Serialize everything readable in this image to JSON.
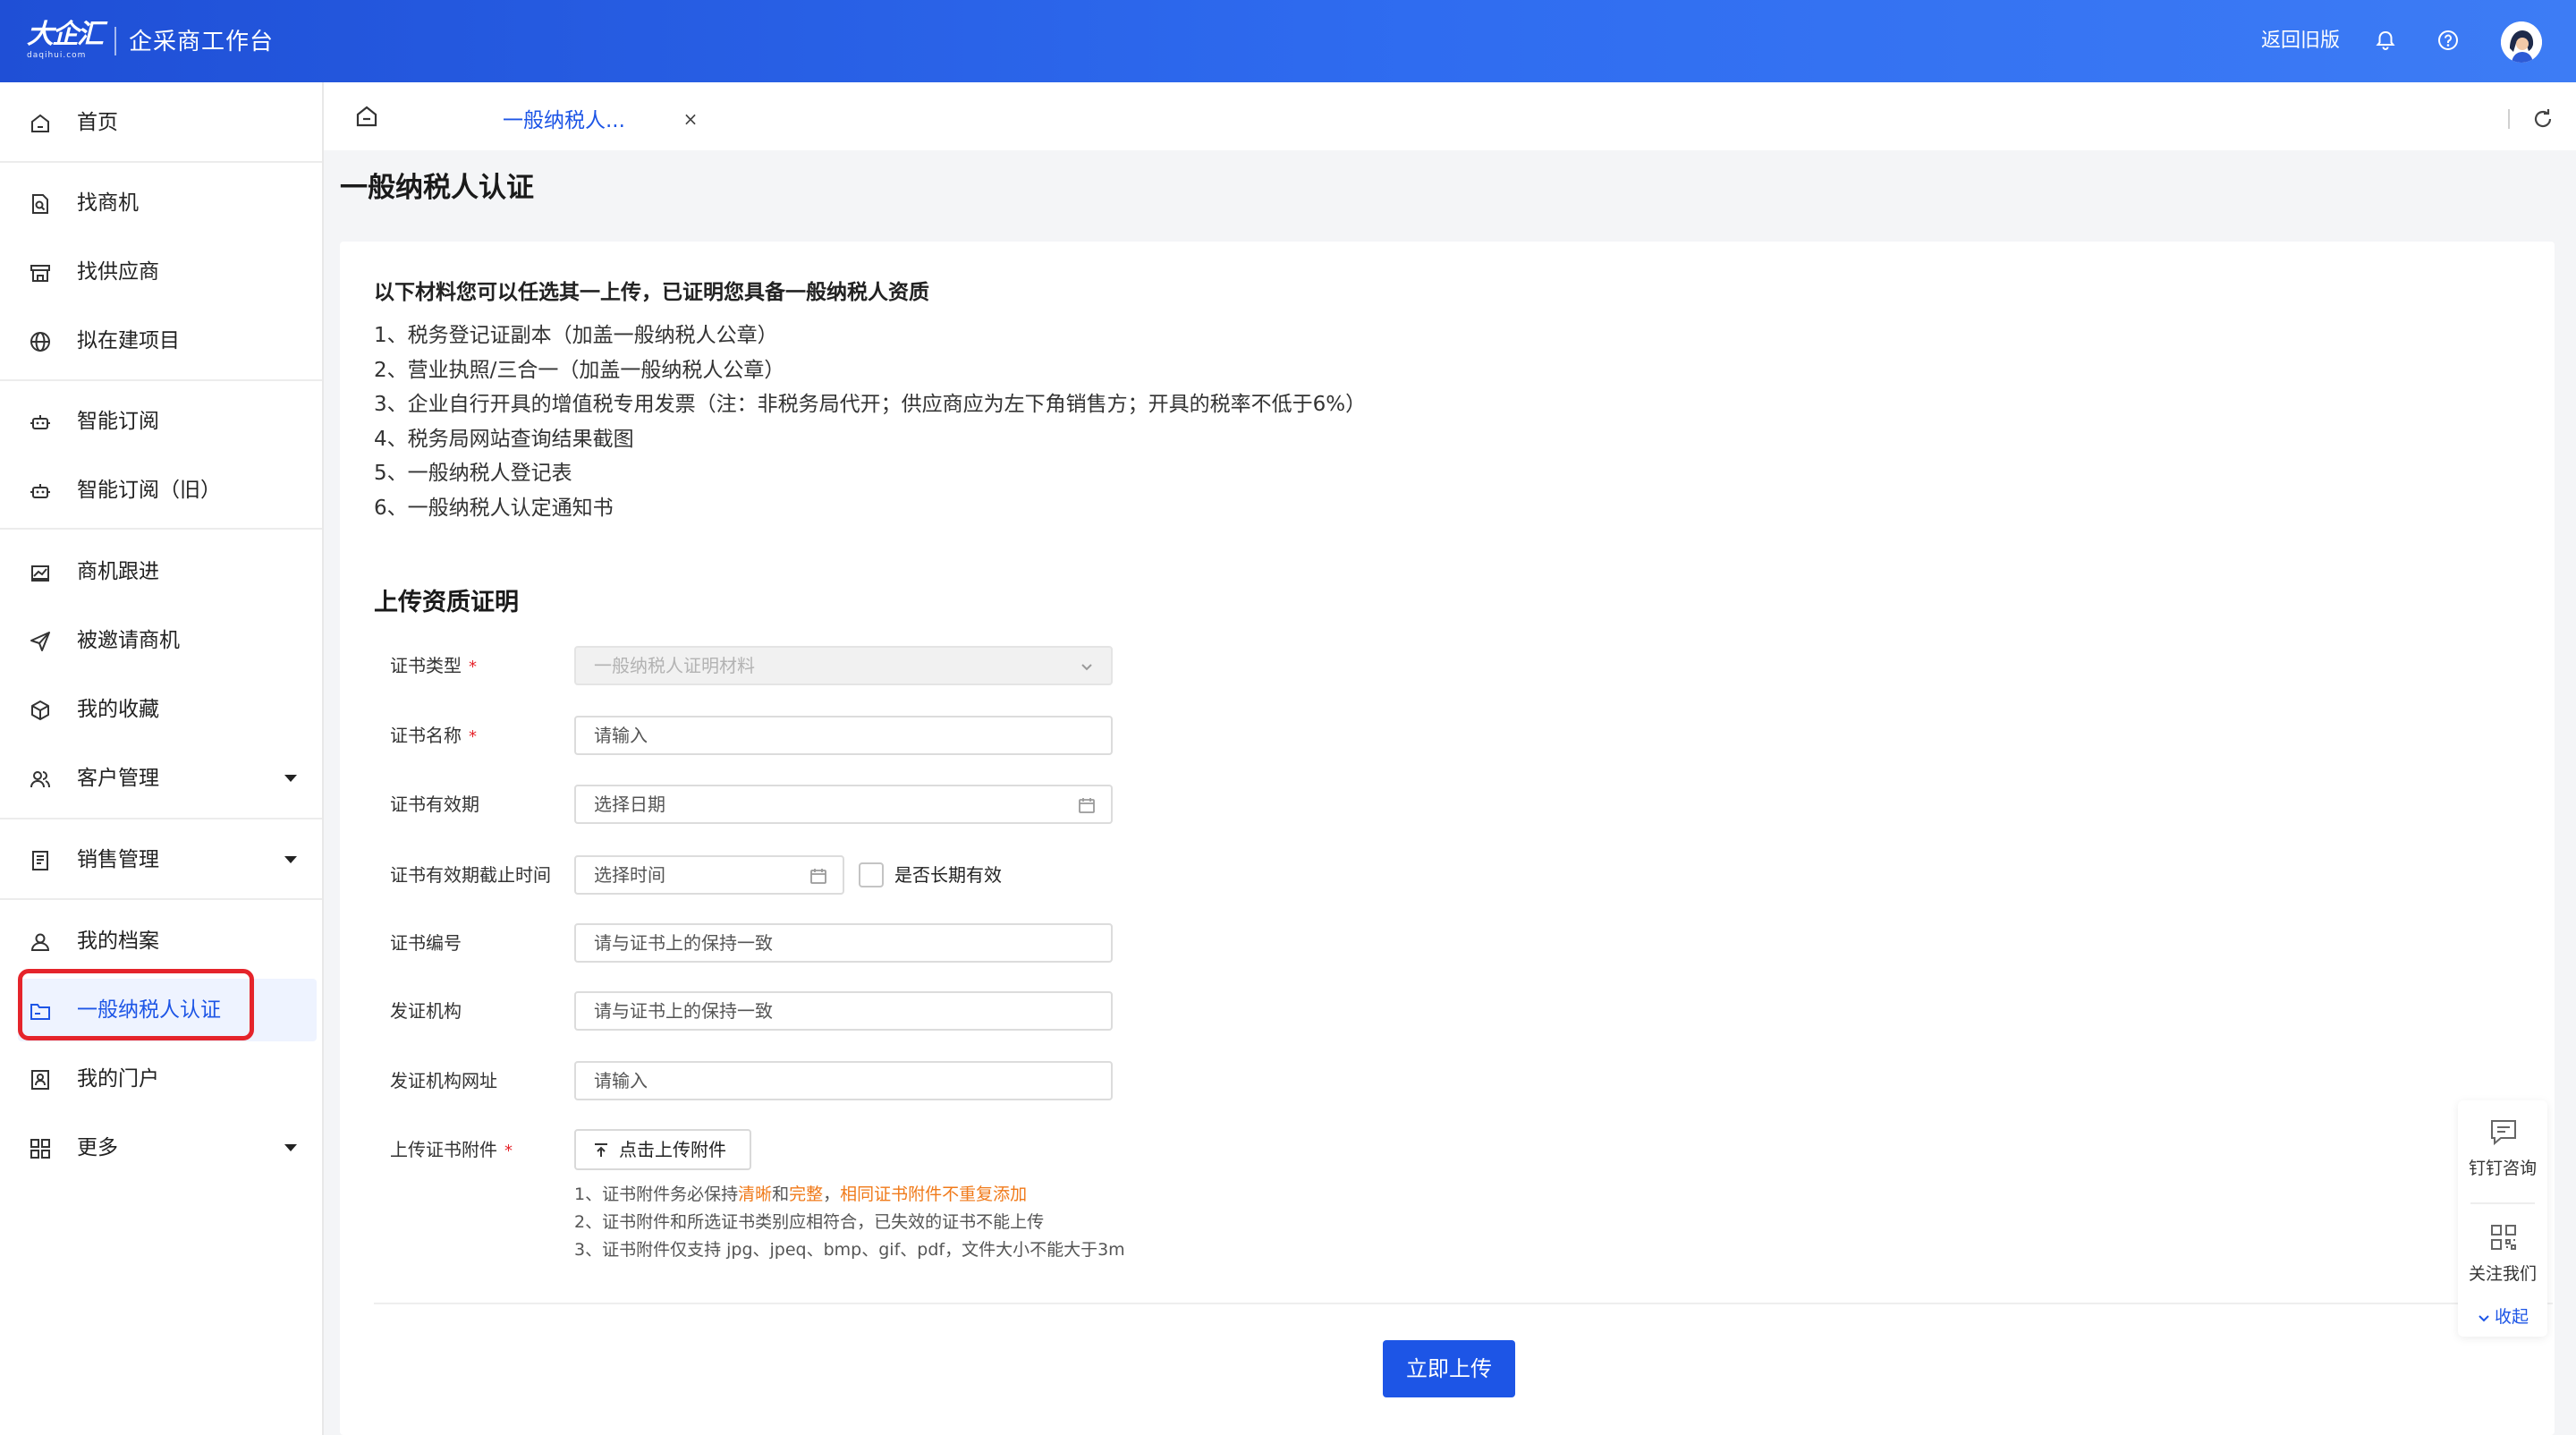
{
  "header": {
    "logo_main": "大企汇",
    "logo_sub": "daqihui.com",
    "app_title": "企采商工作台",
    "back_old": "返回旧版"
  },
  "sidebar": {
    "items": [
      {
        "label": "首页",
        "icon": "home-icon"
      },
      {
        "label": "找商机",
        "icon": "search-doc-icon"
      },
      {
        "label": "找供应商",
        "icon": "store-icon"
      },
      {
        "label": "拟在建项目",
        "icon": "globe-icon"
      },
      {
        "label": "智能订阅",
        "icon": "robot-icon"
      },
      {
        "label": "智能订阅（旧）",
        "icon": "robot-icon"
      },
      {
        "label": "商机跟进",
        "icon": "chart-icon"
      },
      {
        "label": "被邀请商机",
        "icon": "send-icon"
      },
      {
        "label": "我的收藏",
        "icon": "box-icon"
      },
      {
        "label": "客户管理",
        "icon": "users-icon"
      },
      {
        "label": "销售管理",
        "icon": "document-icon"
      },
      {
        "label": "我的档案",
        "icon": "user-icon"
      },
      {
        "label": "一般纳税人认证",
        "icon": "folder-icon"
      },
      {
        "label": "我的门户",
        "icon": "portal-icon"
      },
      {
        "label": "更多",
        "icon": "grid-icon"
      }
    ]
  },
  "tabs": {
    "active_label": "一般纳税人...",
    "close": "×"
  },
  "page": {
    "title": "一般纳税人认证"
  },
  "intro": {
    "title": "以下材料您可以任选其一上传，已证明您具备一般纳税人资质",
    "items": [
      "1、税务登记证副本（加盖一般纳税人公章）",
      "2、营业执照/三合一（加盖一般纳税人公章）",
      "3、企业自行开具的增值税专用发票（注：非税务局代开；供应商应为左下角销售方；开具的税率不低于6%）",
      "4、税务局网站查询结果截图",
      "5、一般纳税人登记表",
      "6、一般纳税人认定通知书"
    ]
  },
  "form": {
    "section_title": "上传资质证明",
    "cert_type_label": "证书类型",
    "cert_type_value": "一般纳税人证明材料",
    "cert_name_label": "证书名称",
    "cert_name_placeholder": "请输入",
    "valid_label": "证书有效期",
    "valid_placeholder": "选择日期",
    "expire_label": "证书有效期截止时间",
    "expire_placeholder": "选择时间",
    "long_term_label": "是否长期有效",
    "cert_no_label": "证书编号",
    "cert_no_placeholder": "请与证书上的保持一致",
    "issuer_label": "发证机构",
    "issuer_placeholder": "请与证书上的保持一致",
    "issuer_url_label": "发证机构网址",
    "issuer_url_placeholder": "请输入",
    "attach_label": "上传证书附件",
    "upload_button": "点击上传附件",
    "required_mark": "*",
    "notes": {
      "n1_prefix": "1、证书附件务必保持",
      "n1_hl1": "清晰",
      "n1_and": "和",
      "n1_hl2": "完整",
      "n1_comma": "，",
      "n1_hl3": "相同证书附件不重复添加",
      "n2": "2、证书附件和所选证书类别应相符合，已失效的证书不能上传",
      "n3": "3、证书附件仅支持 jpg、jpeq、bmp、gif、pdf，文件大小不能大于3m"
    },
    "submit": "立即上传"
  },
  "float_widget": {
    "consult": "钉钉咨询",
    "follow": "关注我们",
    "collapse": "收起"
  },
  "colors": {
    "primary": "#1d55e6",
    "header_start": "#1f4fd6",
    "header_end": "#3d7cf5",
    "highlight": "#f07a1a",
    "required": "#e5242b"
  }
}
